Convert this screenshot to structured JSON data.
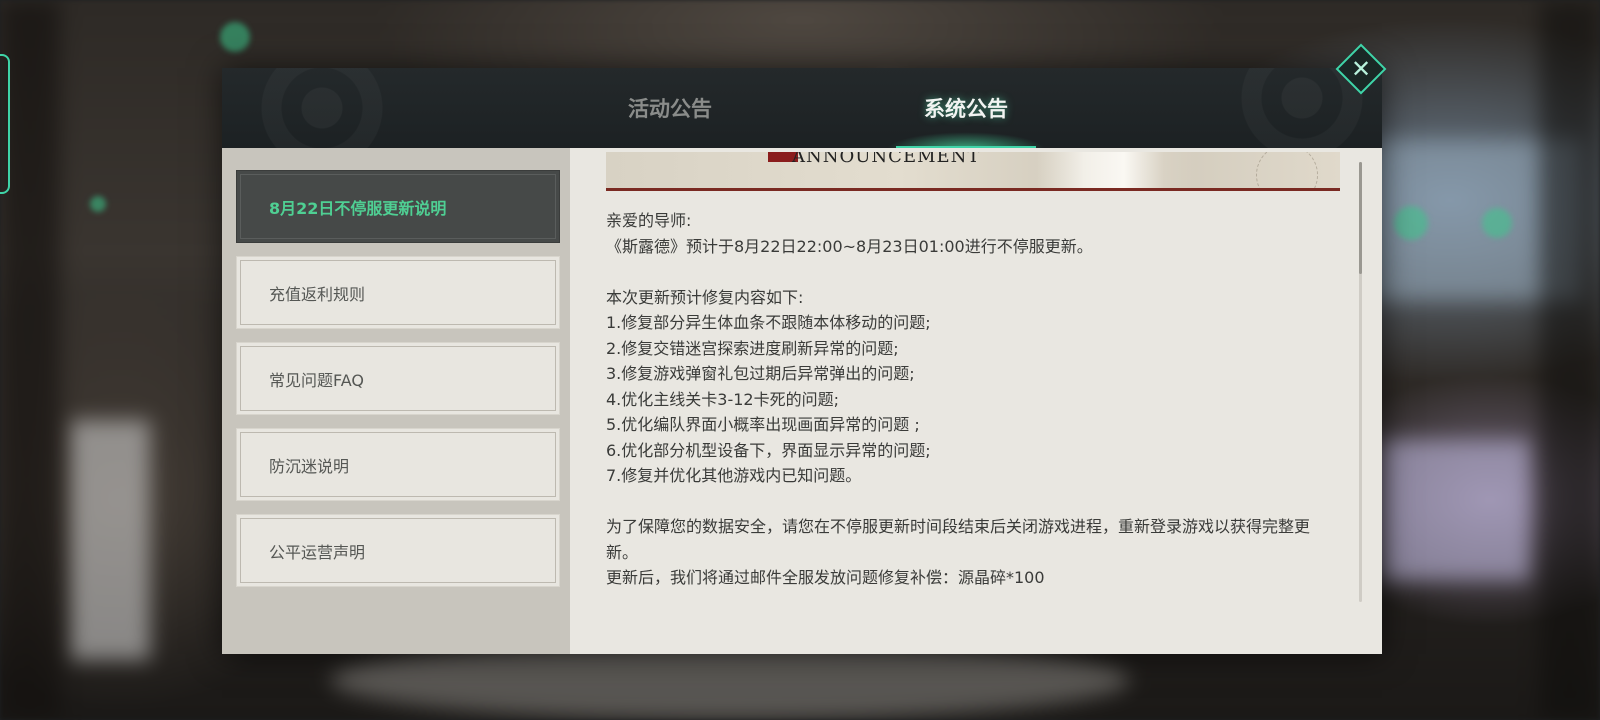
{
  "tabs": {
    "activity": "活动公告",
    "system": "系统公告",
    "active": "system"
  },
  "sidebar": {
    "items": [
      {
        "label": "8月22日不停服更新说明",
        "active": true
      },
      {
        "label": "充值返利规则",
        "active": false
      },
      {
        "label": "常见问题FAQ",
        "active": false
      },
      {
        "label": "防沉迷说明",
        "active": false
      },
      {
        "label": "公平运营声明",
        "active": false
      }
    ]
  },
  "content": {
    "banner_text": "ANNOUNCEMENT",
    "greeting": "亲爱的导师:",
    "intro": "《斯露德》预计于8月22日22:00~8月23日01:00进行不停服更新。",
    "list_heading": "本次更新预计修复内容如下:",
    "fixes": [
      "1.修复部分异生体血条不跟随本体移动的问题;",
      "2.修复交错迷宫探索进度刷新异常的问题;",
      "3.修复游戏弹窗礼包过期后异常弹出的问题;",
      "4.优化主线关卡3-12卡死的问题;",
      "5.优化编队界面小概率出现画面异常的问题 ;",
      "6.优化部分机型设备下，界面显示异常的问题;",
      "7.修复并优化其他游戏内已知问题。"
    ],
    "safety_note": "为了保障您的数据安全，请您在不停服更新时间段结束后关闭游戏进程，重新登录游戏以获得完整更新。",
    "compensation": "更新后，我们将通过邮件全服发放问题修复补偿：源晶碎*100"
  },
  "icons": {
    "close": "close-icon"
  },
  "colors": {
    "accent": "#3fd4a8",
    "active_item_text": "#4fcf93",
    "active_item_bg": "#464948",
    "header_bg": "#1f2426",
    "content_bg": "#e9e7e1"
  }
}
